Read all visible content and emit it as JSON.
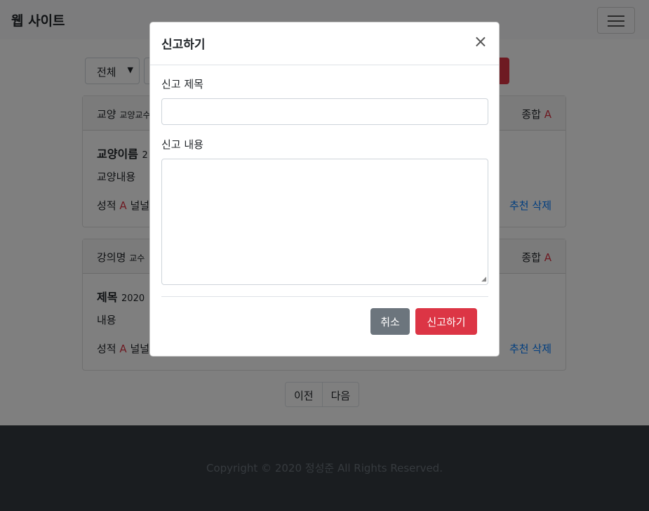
{
  "navbar": {
    "brand": "웹 사이트"
  },
  "filter": {
    "select_value": "전체"
  },
  "cards": [
    {
      "header_title": "교양",
      "header_sub": "교양교수",
      "overall_label": "종합",
      "overall_grade": "A",
      "body_title": "교양이름",
      "body_title_sub": "2",
      "content": "교양내용",
      "grade_label": "성적",
      "grade_value": "A",
      "grade_tail": "널널",
      "recommend": "추천",
      "delete": "삭제"
    },
    {
      "header_title": "강의명",
      "header_sub": "교수",
      "overall_label": "종합",
      "overall_grade": "A",
      "body_title": "제목",
      "body_title_sub": "2020",
      "content": "내용",
      "grade_label": "성적",
      "grade_value": "A",
      "grade_tail": "널널",
      "recommend": "추천",
      "delete": "삭제"
    }
  ],
  "pager": {
    "prev": "이전",
    "next": "다음"
  },
  "footer": {
    "copyright": "Copyright © 2020 정성준 All Rights Reserved."
  },
  "modal": {
    "title": "신고하기",
    "close_glyph": "×",
    "subject_label": "신고 제목",
    "subject_value": "",
    "content_label": "신고 내용",
    "content_value": "",
    "cancel_label": "취소",
    "submit_label": "신고하기"
  },
  "colors": {
    "danger": "#dc3545",
    "secondary": "#6c757d",
    "primary": "#007bff",
    "footer": "#343a40"
  }
}
